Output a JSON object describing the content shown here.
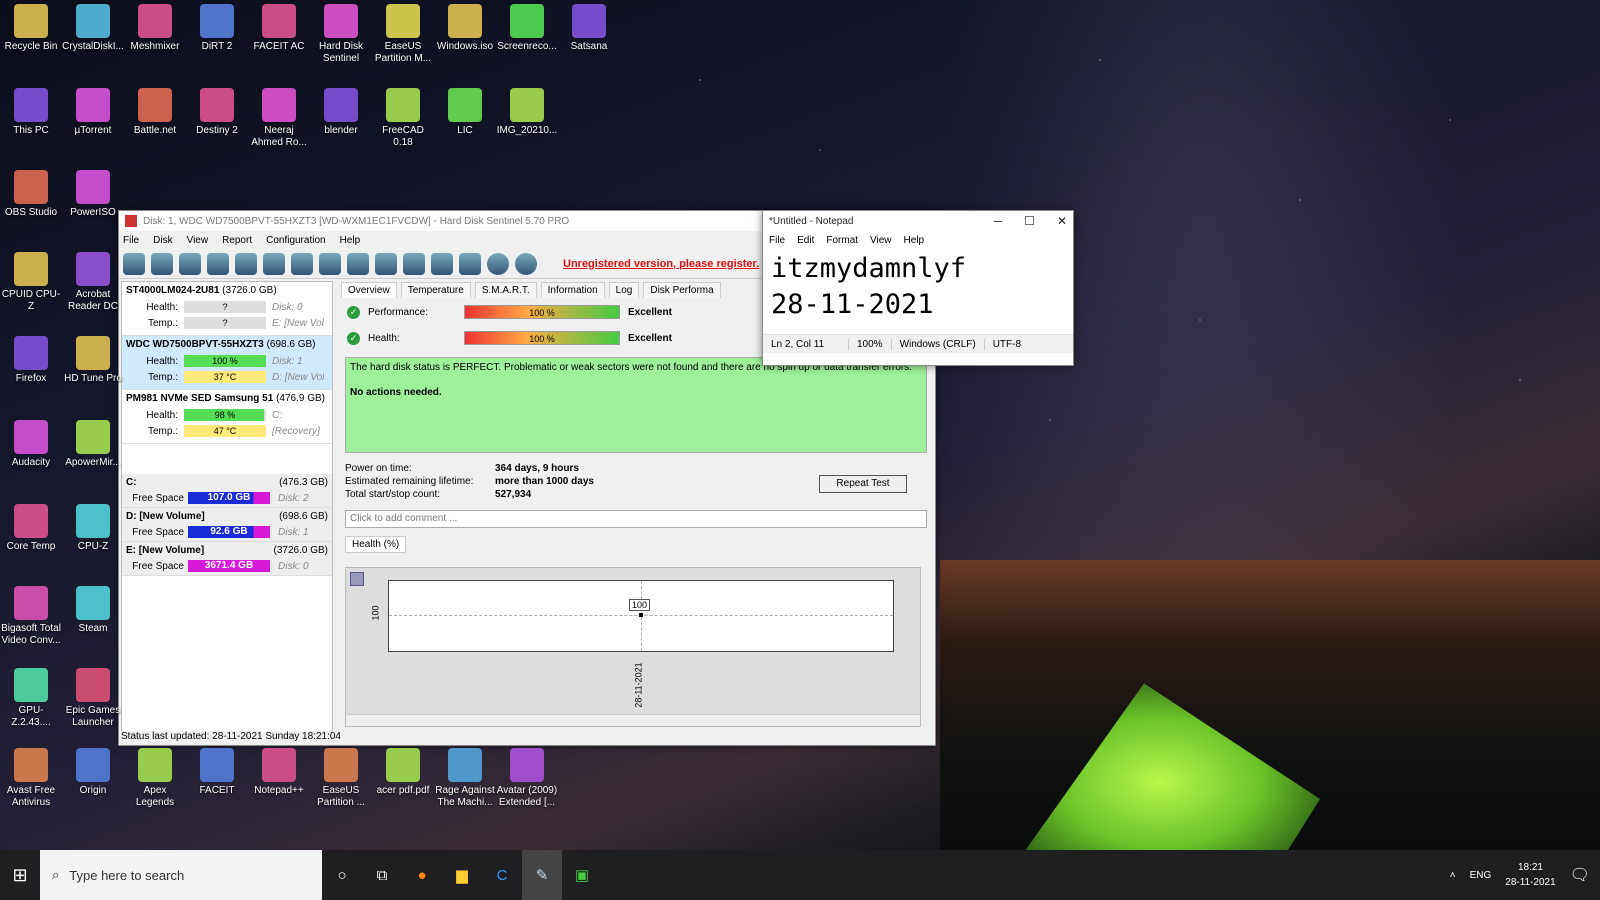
{
  "desktop": {
    "col1": [
      "Recycle Bin",
      "This PC",
      "OBS Studio",
      "CPUID CPU-Z",
      "Firefox",
      "Audacity",
      "Core Temp",
      "Bigasoft Total Video Conv...",
      "GPU-Z.2.43....",
      "Avast Free Antivirus"
    ],
    "col2": [
      "CrystalDiskI...",
      "µTorrent",
      "PowerISO",
      "Acrobat Reader DC",
      "HD Tune Pro",
      "ApowerMir...",
      "CPU-Z",
      "Steam",
      "Epic Games Launcher",
      "Origin"
    ],
    "row_top": [
      "Meshmixer",
      "DiRT 2",
      "FACEIT AC",
      "Hard Disk Sentinel",
      "EaseUS Partition M...",
      "Windows.iso",
      "Screenreco...",
      "Satsana"
    ],
    "row_second": [
      "Battle.net",
      "Destiny 2",
      "Neeraj Ahmed Ro...",
      "blender",
      "FreeCAD 0.18",
      "LIC",
      "IMG_20210..."
    ],
    "row_bottom": [
      "Apex Legends",
      "FACEIT",
      "Notepad++",
      "EaseUS Partition ...",
      "acer pdf.pdf",
      "Rage Against The Machi...",
      "Avatar (2009) Extended [..."
    ]
  },
  "hds": {
    "title": "Disk: 1, WDC WD7500BPVT-55HXZT3 [WD-WXM1EC1FVCDW] - Hard Disk Sentinel 5.70 PRO",
    "menu": [
      "File",
      "Disk",
      "View",
      "Report",
      "Configuration",
      "Help"
    ],
    "unregistered": "Unregistered version, please register.",
    "disks": [
      {
        "name": "ST4000LM024-2U81",
        "size": "(3726.0 GB)",
        "health": "?",
        "temp": "?",
        "extra1": "Disk: 0",
        "extra2": "E: [New Volume]",
        "health_pct": 0,
        "status": "?"
      },
      {
        "name": "WDC WD7500BPVT-55HXZT3",
        "size": "(698.6 GB)",
        "health": "100 %",
        "temp": "37 °C",
        "extra1": "Disk: 1",
        "extra2": "D: [New Volume]",
        "health_pct": 100,
        "status": "✓"
      },
      {
        "name": "PM981 NVMe SED Samsung 51",
        "size": "(476.9 GB)",
        "health": "98 %",
        "temp": "47 °C",
        "extra1": "C:",
        "extra2": "[Recovery]",
        "health_pct": 98,
        "status": "✓"
      }
    ],
    "labels": {
      "health": "Health:",
      "temp": "Temp.:",
      "free_space": "Free Space"
    },
    "volumes": [
      {
        "name": "C:",
        "size": "(476.3 GB)",
        "free": "107.0 GB",
        "disk": "Disk: 2"
      },
      {
        "name": "D: [New Volume]",
        "size": "(698.6 GB)",
        "free": "92.6 GB",
        "disk": "Disk: 1"
      },
      {
        "name": "E: [New Volume]",
        "size": "(3726.0 GB)",
        "free": "3671.4 GB",
        "disk": "Disk: 0"
      }
    ],
    "tabs": [
      "Overview",
      "Temperature",
      "S.M.A.R.T.",
      "Information",
      "Log",
      "Disk Performa"
    ],
    "performance": {
      "label": "Performance:",
      "value": "100 %",
      "result": "Excellent",
      "pct": 100
    },
    "health": {
      "label": "Health:",
      "value": "100 %",
      "result": "Excellent",
      "pct": 100
    },
    "status_text": "The hard disk status is PERFECT. Problematic or weak sectors were not found and there are no spin up or data transfer errors.",
    "status_action": "No actions needed.",
    "stats": [
      {
        "k": "Power on time:",
        "v": "364 days, 9 hours"
      },
      {
        "k": "Estimated remaining lifetime:",
        "v": "more than 1000 days"
      },
      {
        "k": "Total start/stop count:",
        "v": "527,934"
      }
    ],
    "repeat_test": "Repeat Test",
    "comment_placeholder": "Click to add comment ...",
    "health_tab": "Health (%)",
    "chart_point_label": "100",
    "chart_y_tick": "100",
    "chart_x_tick": "28-11-2021",
    "status_bar": "Status last updated: 28-11-2021 Sunday 18:21:04"
  },
  "notepad": {
    "title": "*Untitled - Notepad",
    "menu": [
      "File",
      "Edit",
      "Format",
      "View",
      "Help"
    ],
    "line1": "itzmydamnlyf",
    "line2": "28-11-2021",
    "status": [
      "Ln 2, Col 11",
      "100%",
      "Windows (CRLF)",
      "UTF-8"
    ]
  },
  "taskbar": {
    "search_placeholder": "Type here to search",
    "lang": "ENG",
    "time": "18:21",
    "date": "28-11-2021"
  },
  "colors": {
    "accent": "#0078d7",
    "health_green": "#4cd04c",
    "freespace_blue": "#1a2bd8",
    "freespace_magenta": "#d81ad8"
  }
}
